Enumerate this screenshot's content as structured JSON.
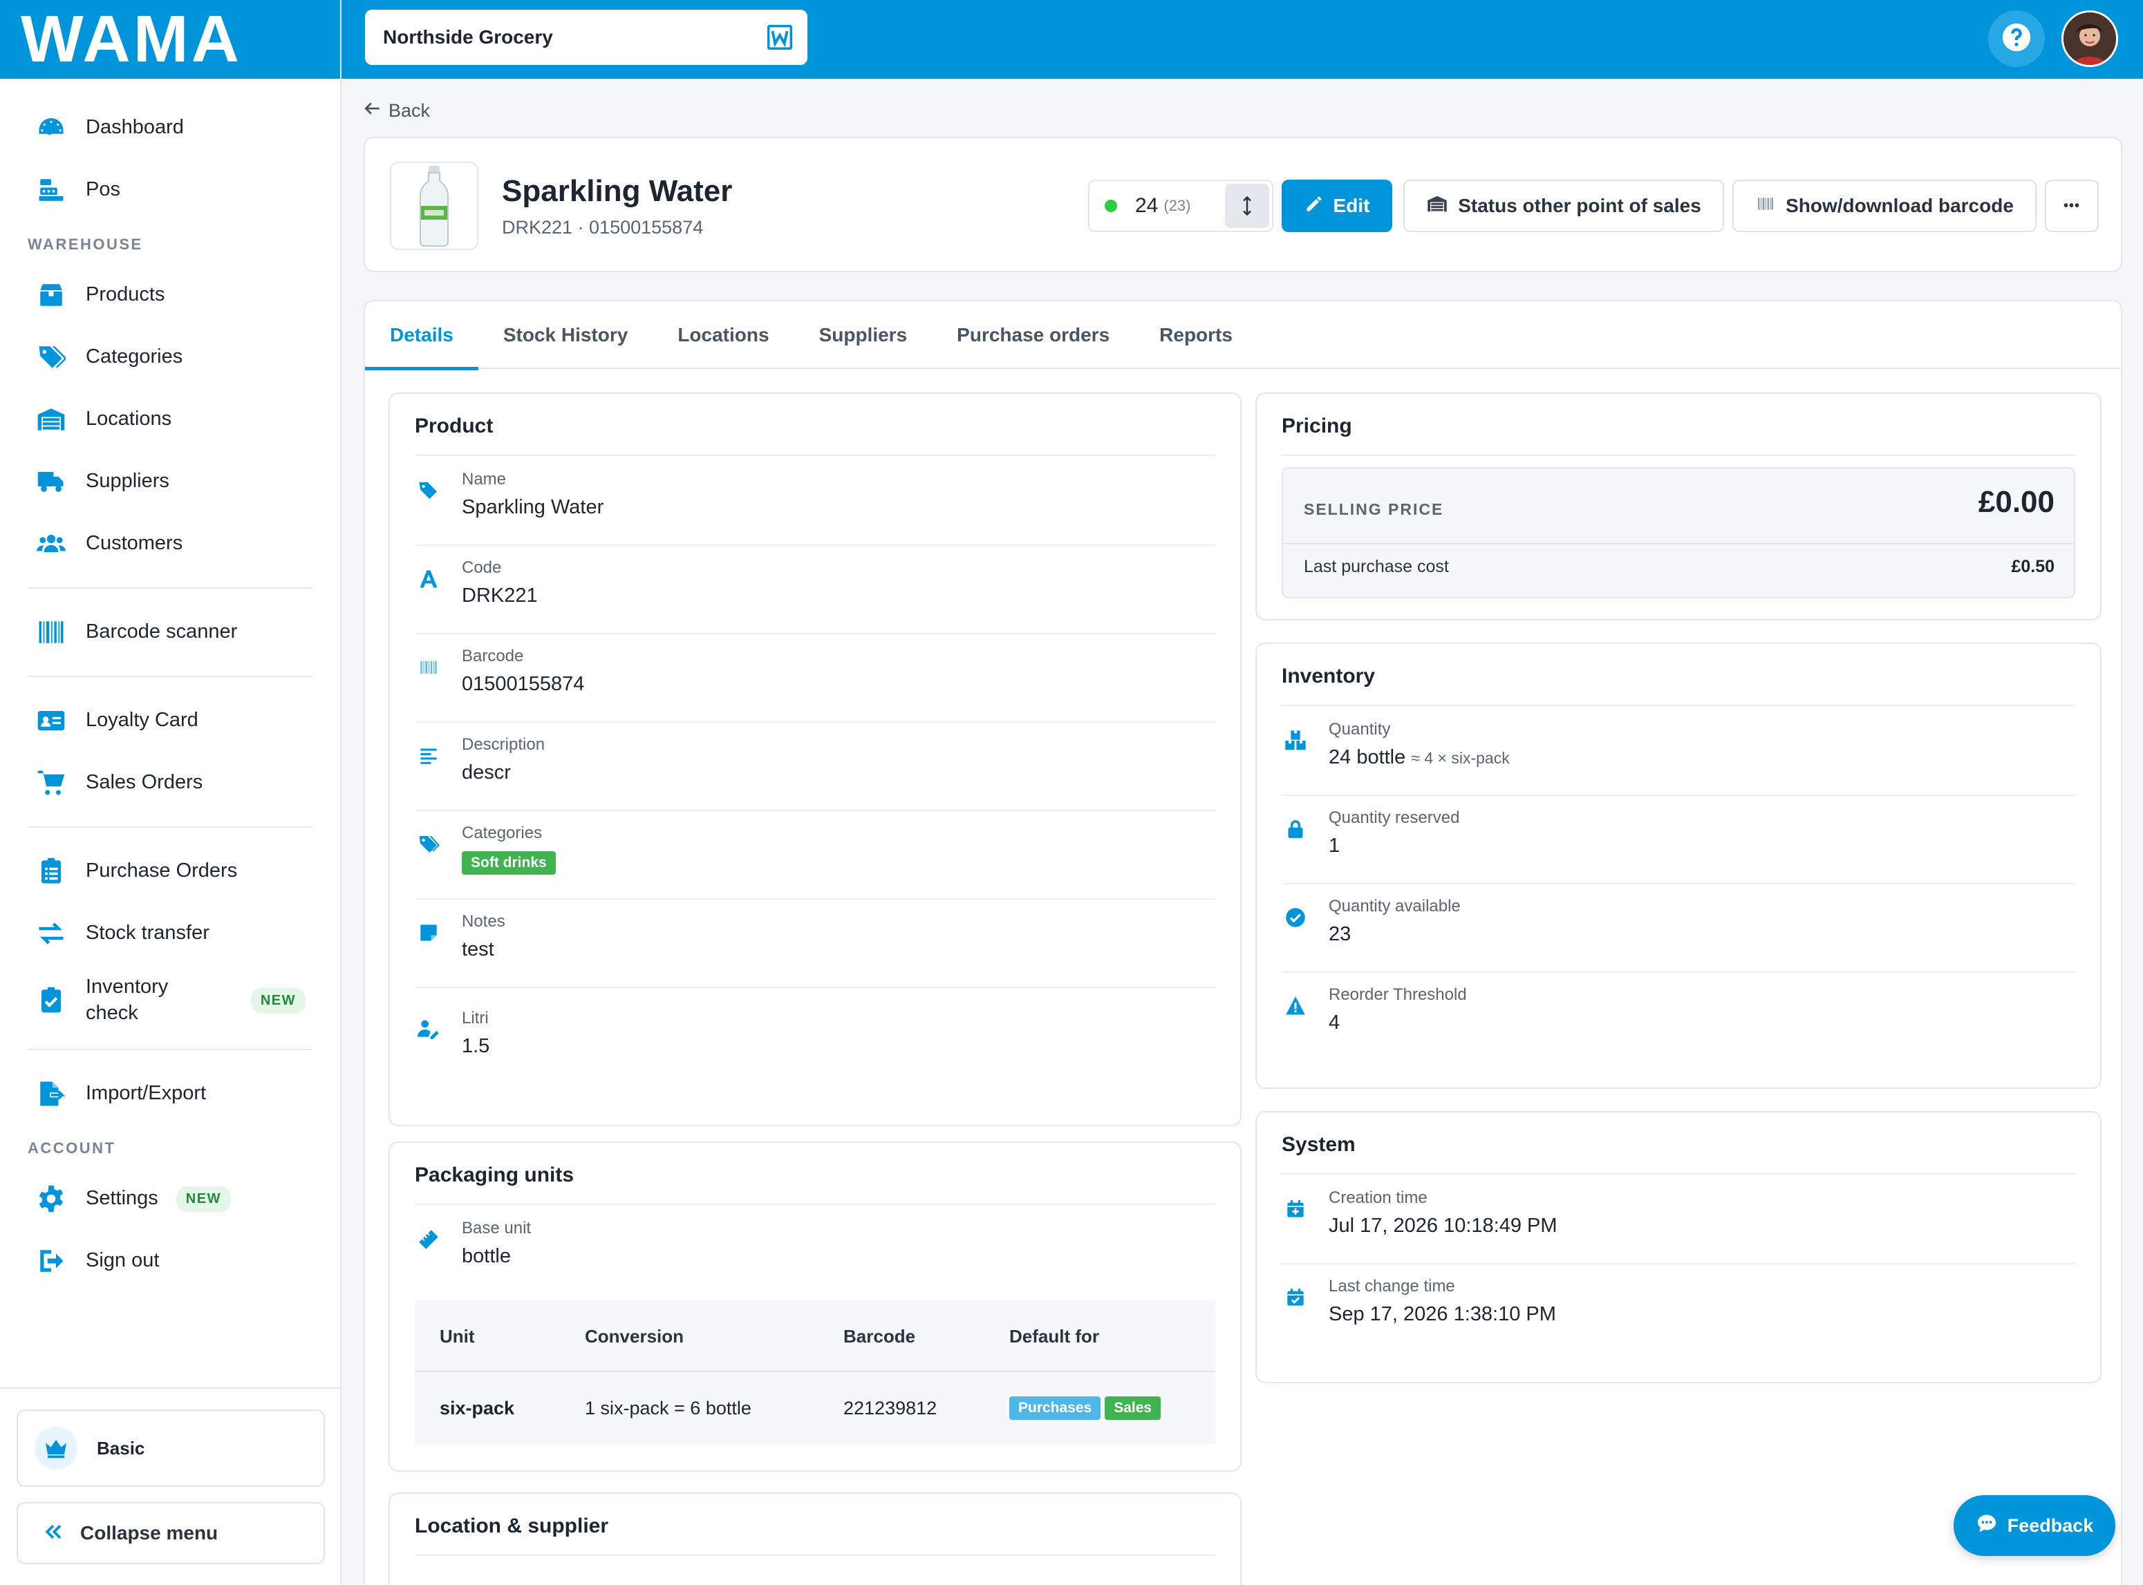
{
  "brand": {
    "logo_text": "WAMA",
    "accent": "#0095da"
  },
  "sidebar": {
    "items_top": [
      {
        "label": "Dashboard",
        "icon": "speedometer-icon"
      },
      {
        "label": "Pos",
        "icon": "cash-register-icon"
      }
    ],
    "warehouse_heading": "WAREHOUSE",
    "warehouse_items": [
      {
        "label": "Products",
        "icon": "box-icon"
      },
      {
        "label": "Categories",
        "icon": "tags-icon"
      },
      {
        "label": "Locations",
        "icon": "warehouse-icon"
      },
      {
        "label": "Suppliers",
        "icon": "truck-icon"
      },
      {
        "label": "Customers",
        "icon": "users-icon"
      }
    ],
    "barcode_scanner": "Barcode scanner",
    "loyalty_card": "Loyalty Card",
    "sales_orders": "Sales Orders",
    "purchase_orders": "Purchase Orders",
    "stock_transfer": "Stock transfer",
    "inventory_check": "Inventory check",
    "new_badge": "NEW",
    "import_export": "Import/Export",
    "account_heading": "ACCOUNT",
    "settings": "Settings",
    "sign_out": "Sign out",
    "plan": "Basic",
    "collapse": "Collapse menu"
  },
  "topbar": {
    "store_name": "Northside Grocery"
  },
  "back_label": "Back",
  "product_header": {
    "title": "Sparkling Water",
    "subtitle": "DRK221 · 01500155874",
    "stock": "24",
    "stock_available": "(23)",
    "edit_label": "Edit",
    "status_label": "Status other point of sales",
    "barcode_label": "Show/download barcode",
    "more_label": "•••"
  },
  "tabs": [
    "Details",
    "Stock History",
    "Locations",
    "Suppliers",
    "Purchase orders",
    "Reports"
  ],
  "product_panel": {
    "title": "Product",
    "fields": [
      {
        "label": "Name",
        "value": "Sparkling Water"
      },
      {
        "label": "Code",
        "value": "DRK221"
      },
      {
        "label": "Barcode",
        "value": "01500155874"
      },
      {
        "label": "Description",
        "value": "descr"
      },
      {
        "label": "Categories",
        "value": "Soft drinks"
      },
      {
        "label": "Notes",
        "value": "test"
      },
      {
        "label": "Litri",
        "value": "1.5"
      }
    ]
  },
  "packaging": {
    "title": "Packaging units",
    "base_label": "Base unit",
    "base_value": "bottle",
    "headers": [
      "Unit",
      "Conversion",
      "Barcode",
      "Default for"
    ],
    "row": {
      "unit": "six-pack",
      "conversion": "1 six-pack = 6 bottle",
      "barcode": "221239812",
      "tag1": "Purchases",
      "tag2": "Sales"
    }
  },
  "location_panel": {
    "title": "Location & supplier"
  },
  "pricing": {
    "title": "Pricing",
    "selling_label": "SELLING PRICE",
    "selling_value": "£0.00",
    "cost_label": "Last purchase cost",
    "cost_value": "£0.50"
  },
  "inventory": {
    "title": "Inventory",
    "quantity_label": "Quantity",
    "quantity_value": "24 bottle",
    "quantity_extra": "≈ 4 × six-pack",
    "reserved_label": "Quantity reserved",
    "reserved_value": "1",
    "available_label": "Quantity available",
    "available_value": "23",
    "threshold_label": "Reorder Threshold",
    "threshold_value": "4"
  },
  "system": {
    "title": "System",
    "created_label": "Creation time",
    "created_value": "Jul 17, 2026 10:18:49 PM",
    "changed_label": "Last change time",
    "changed_value": "Sep 17, 2026 1:38:10 PM"
  },
  "feedback_label": "Feedback"
}
